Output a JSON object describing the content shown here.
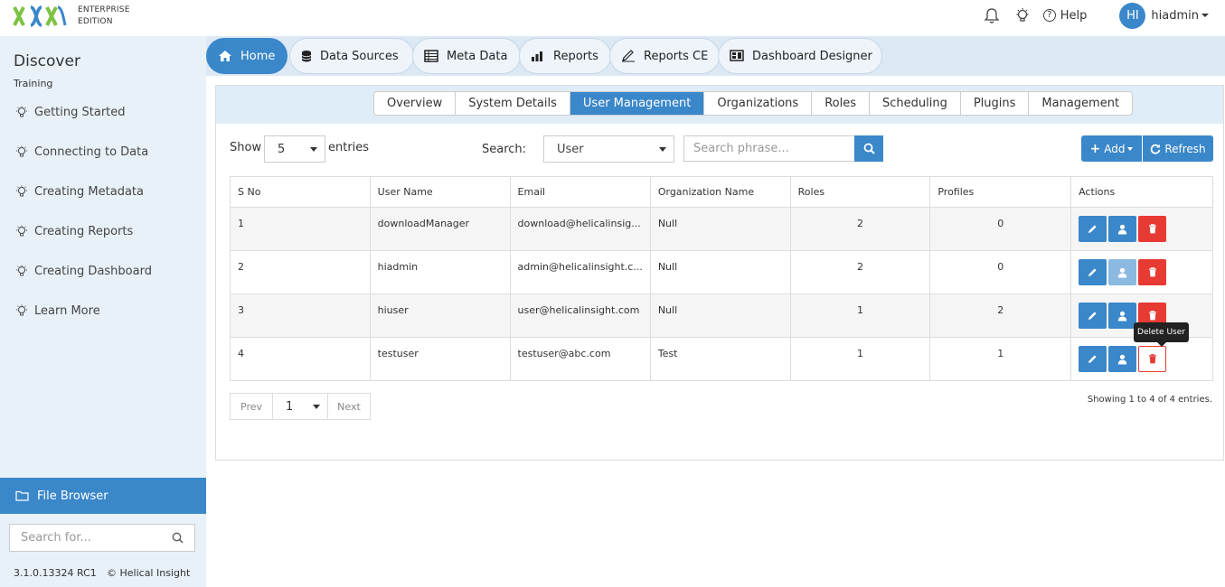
{
  "brand": {
    "line1": "ENTERPRISE",
    "line2": "EDITION"
  },
  "topbar": {
    "help_label": "Help",
    "avatar_initials": "HI",
    "user_name": "hiadmin"
  },
  "sidebar": {
    "title": "Discover",
    "subtitle": "Training",
    "items": [
      {
        "label": "Getting Started"
      },
      {
        "label": "Connecting to Data"
      },
      {
        "label": "Creating Metadata"
      },
      {
        "label": "Creating Reports"
      },
      {
        "label": "Creating Dashboard"
      },
      {
        "label": "Learn More"
      }
    ],
    "file_browser": "File Browser",
    "search_placeholder": "Search for...",
    "version": "3.1.0.13324 RC1",
    "copyright": "© Helical Insight"
  },
  "nav_tabs": [
    {
      "label": "Home",
      "active": true
    },
    {
      "label": "Data Sources"
    },
    {
      "label": "Meta Data"
    },
    {
      "label": "Reports"
    },
    {
      "label": "Reports CE"
    },
    {
      "label": "Dashboard Designer"
    }
  ],
  "sub_tabs": [
    {
      "label": "Overview"
    },
    {
      "label": "System Details"
    },
    {
      "label": "User Management",
      "active": true
    },
    {
      "label": "Organizations"
    },
    {
      "label": "Roles"
    },
    {
      "label": "Scheduling"
    },
    {
      "label": "Plugins"
    },
    {
      "label": "Management"
    }
  ],
  "controls": {
    "show_label": "Show",
    "show_value": "5",
    "entries_label": "entries",
    "search_label": "Search:",
    "search_type": "User",
    "search_placeholder": "Search phrase...",
    "add_label": "Add",
    "refresh_label": "Refresh"
  },
  "table": {
    "columns": [
      "S No",
      "User Name",
      "Email",
      "Organization Name",
      "Roles",
      "Profiles",
      "Actions"
    ],
    "rows": [
      {
        "sno": "1",
        "user": "downloadManager",
        "email": "download@helicalinsig...",
        "org": "Null",
        "roles": "2",
        "profiles": "0"
      },
      {
        "sno": "2",
        "user": "hiadmin",
        "email": "admin@helicalinsight.c...",
        "org": "Null",
        "roles": "2",
        "profiles": "0"
      },
      {
        "sno": "3",
        "user": "hiuser",
        "email": "user@helicalinsight.com",
        "org": "Null",
        "roles": "1",
        "profiles": "2"
      },
      {
        "sno": "4",
        "user": "testuser",
        "email": "testuser@abc.com",
        "org": "Test",
        "roles": "1",
        "profiles": "1"
      }
    ]
  },
  "tooltip": "Delete User",
  "pager": {
    "prev": "Prev",
    "page": "1",
    "next": "Next"
  },
  "showing": "Showing 1 to 4 of 4 entries.",
  "colors": {
    "accent": "#3a87c9",
    "danger": "#e63a33",
    "sidebar_bg": "#e8f1f8"
  }
}
